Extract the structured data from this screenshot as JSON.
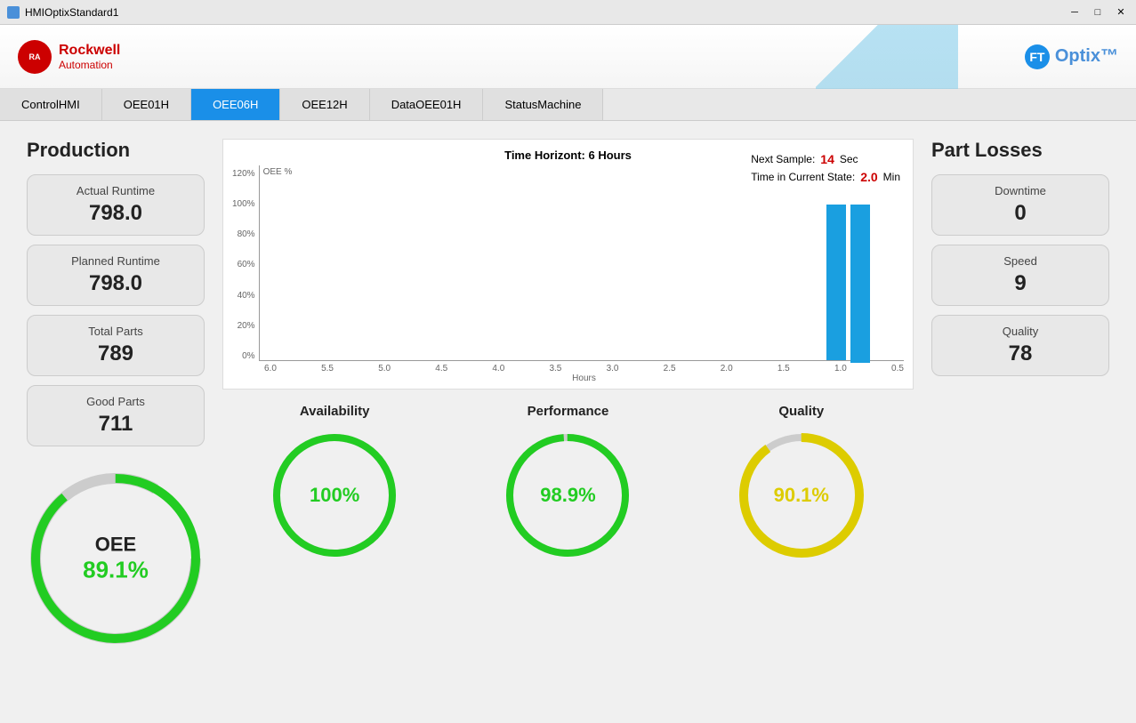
{
  "titleBar": {
    "title": "HMIOptixStandard1"
  },
  "nav": {
    "tabs": [
      {
        "label": "ControlHMI",
        "active": false
      },
      {
        "label": "OEE01H",
        "active": false
      },
      {
        "label": "OEE06H",
        "active": true
      },
      {
        "label": "OEE12H",
        "active": false
      },
      {
        "label": "DataOEE01H",
        "active": false
      },
      {
        "label": "StatusMachine",
        "active": false
      }
    ]
  },
  "production": {
    "title": "Production",
    "metrics": [
      {
        "label": "Actual Runtime",
        "value": "798.0"
      },
      {
        "label": "Planned Runtime",
        "value": "798.0"
      },
      {
        "label": "Total Parts",
        "value": "789"
      },
      {
        "label": "Good Parts",
        "value": "711"
      }
    ]
  },
  "chart": {
    "title": "Time Horizont: 6 Hours",
    "yAxisLabel": "OEE %",
    "xAxisLabel": "Hours",
    "nextSampleLabel": "Next Sample:",
    "nextSampleValue": "14",
    "nextSampleUnit": "Sec",
    "timeInStateLabel": "Time in Current State:",
    "timeInStateValue": "2.0",
    "timeInStateUnit": "Min",
    "xLabels": [
      "6.0",
      "5.5",
      "5.0",
      "4.5",
      "4.0",
      "3.5",
      "3.0",
      "2.5",
      "2.0",
      "1.5",
      "1.0",
      "0.5"
    ],
    "yLabels": [
      "120%",
      "100%",
      "80%",
      "60%",
      "40%",
      "20%",
      "0%"
    ]
  },
  "partLosses": {
    "title": "Part Losses",
    "metrics": [
      {
        "label": "Downtime",
        "value": "0"
      },
      {
        "label": "Speed",
        "value": "9"
      },
      {
        "label": "Quality",
        "value": "78"
      }
    ]
  },
  "oeeGauge": {
    "label": "OEE",
    "value": "89.1%",
    "color": "#22cc22",
    "percent": 89.1
  },
  "bottomGauges": [
    {
      "title": "Availability",
      "value": "100%",
      "color": "#22cc22",
      "percent": 100
    },
    {
      "title": "Performance",
      "value": "98.9%",
      "color": "#22cc22",
      "percent": 98.9
    },
    {
      "title": "Quality",
      "value": "90.1%",
      "color": "#ddcc00",
      "percent": 90.1
    }
  ]
}
